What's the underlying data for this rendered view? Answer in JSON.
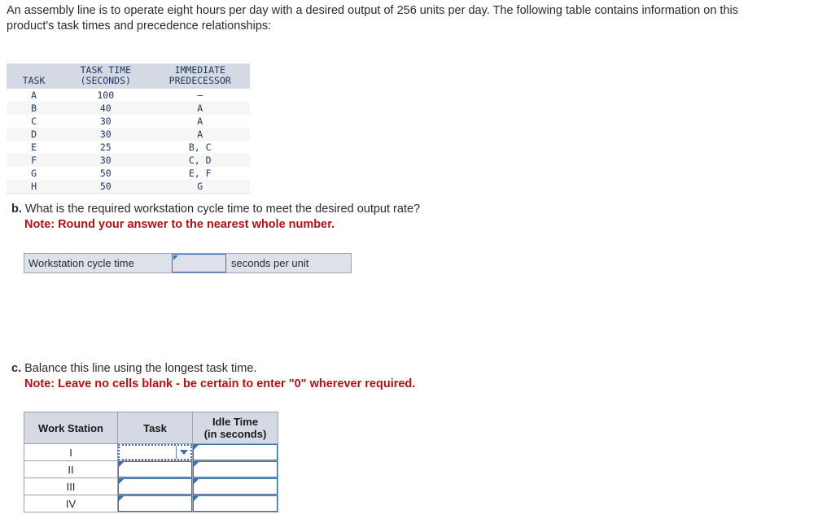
{
  "intro": "An assembly line is to operate eight hours per day with a desired output of 256 units per day. The following table contains information on this product's task times and precedence relationships:",
  "task_table": {
    "headers": {
      "task": "TASK",
      "time_line1": "TASK TIME",
      "time_line2": "(SECONDS)",
      "pred_line1": "IMMEDIATE",
      "pred_line2": "PREDECESSOR"
    },
    "rows": [
      {
        "task": "A",
        "time": "100",
        "predecessor": "—"
      },
      {
        "task": "B",
        "time": "40",
        "predecessor": "A"
      },
      {
        "task": "C",
        "time": "30",
        "predecessor": "A"
      },
      {
        "task": "D",
        "time": "30",
        "predecessor": "A"
      },
      {
        "task": "E",
        "time": "25",
        "predecessor": "B, C"
      },
      {
        "task": "F",
        "time": "30",
        "predecessor": "C, D"
      },
      {
        "task": "G",
        "time": "50",
        "predecessor": "E, F"
      },
      {
        "task": "H",
        "time": "50",
        "predecessor": "G"
      }
    ]
  },
  "question_b": {
    "label": "b.",
    "text": "What is the required workstation cycle time to meet the desired output rate?",
    "note": "Note: Round your answer to the nearest whole number.",
    "answer_row": {
      "label": "Workstation cycle time",
      "value": "",
      "unit": "seconds per unit"
    }
  },
  "question_c": {
    "label": "c.",
    "text": "Balance this line using the longest task time.",
    "note": "Note: Leave no cells blank - be certain to enter \"0\" wherever required.",
    "table": {
      "headers": {
        "work_station": "Work Station",
        "task": "Task",
        "idle_line1": "Idle Time",
        "idle_line2": "(in seconds)"
      },
      "rows": [
        {
          "station": "I",
          "task": "",
          "idle": ""
        },
        {
          "station": "II",
          "task": "",
          "idle": ""
        },
        {
          "station": "III",
          "task": "",
          "idle": ""
        },
        {
          "station": "IV",
          "task": "",
          "idle": ""
        }
      ]
    }
  },
  "colors": {
    "header_bg": "#d4d9e3",
    "stripe_bg": "#f6f6f6",
    "input_border": "#3f6fae",
    "note_red": "#b01116",
    "strip_bg": "#dde1ea"
  }
}
